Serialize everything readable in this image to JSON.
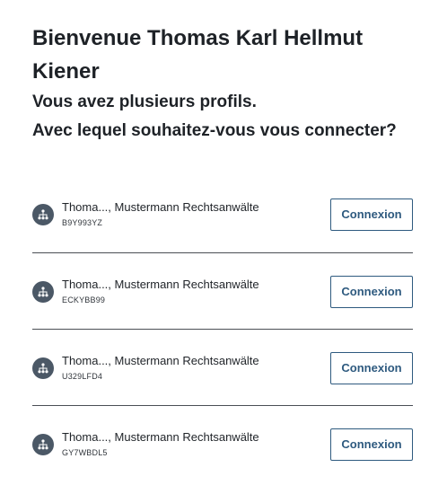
{
  "header": {
    "title": "Bienvenue Thomas Karl Hellmut Kiener",
    "subtitle_line1": "Vous avez plusieurs profils.",
    "subtitle_line2": "Avec lequel souhaitez-vous vous connecter?"
  },
  "profiles": [
    {
      "name": "Thoma..., Mustermann Rechtsanwälte",
      "id": "B9Y993YZ",
      "button_label": "Connexion",
      "icon": "organization-icon"
    },
    {
      "name": "Thoma..., Mustermann Rechtsanwälte",
      "id": "ECKYBB99",
      "button_label": "Connexion",
      "icon": "organization-icon"
    },
    {
      "name": "Thoma..., Mustermann Rechtsanwälte",
      "id": "U329LFD4",
      "button_label": "Connexion",
      "icon": "organization-icon"
    },
    {
      "name": "Thoma..., Mustermann Rechtsanwälte",
      "id": "GY7WBDL5",
      "button_label": "Connexion",
      "icon": "organization-icon"
    }
  ],
  "colors": {
    "accent": "#2e5a7f",
    "avatar_bg": "#4b5866",
    "divider": "#4a4f55"
  }
}
